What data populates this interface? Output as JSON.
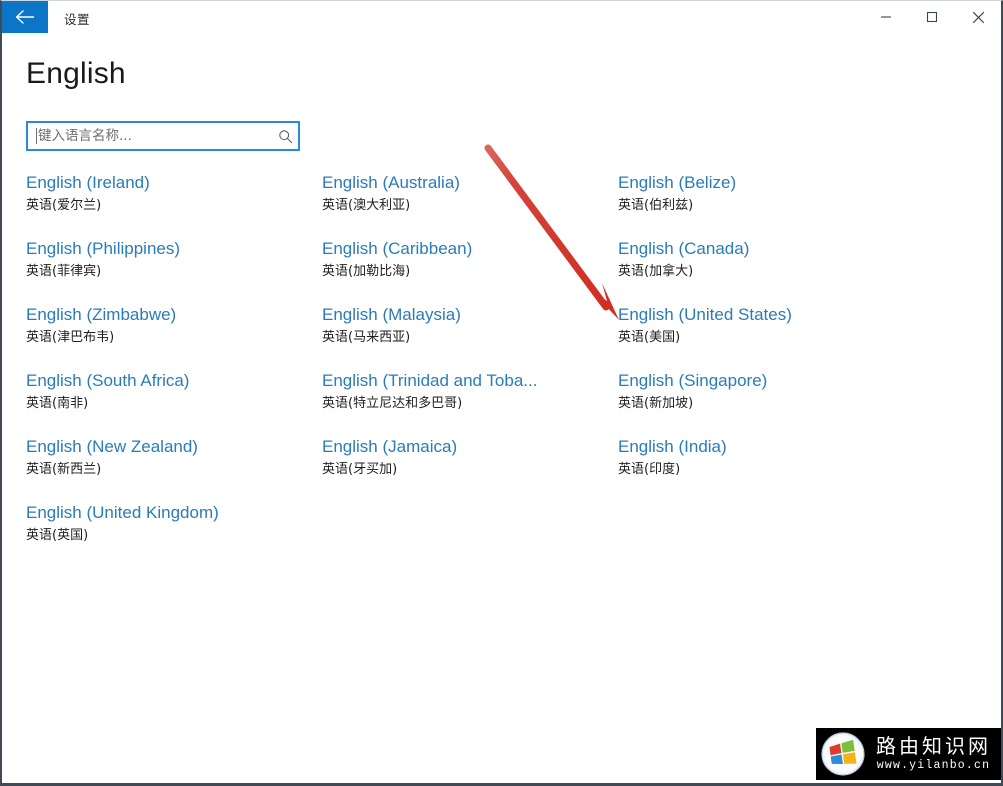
{
  "window": {
    "titlebar": {
      "back_label": "back-arrow",
      "title": "设置",
      "controls": {
        "minimize": "minimize-icon",
        "maximize": "maximize-icon",
        "close": "close-icon"
      }
    },
    "accent_color": "#0b76c8",
    "link_color": "#2a7cb8",
    "border_color": "#414a56"
  },
  "page": {
    "title": "English"
  },
  "search": {
    "placeholder": "键入语言名称...",
    "value": "",
    "icon": "search-icon",
    "border_color": "#2a8ad4"
  },
  "languages": {
    "columns": [
      {
        "items": [
          {
            "name": "English (Ireland)",
            "native": "英语(爱尔兰)"
          },
          {
            "name": "English (Philippines)",
            "native": "英语(菲律宾)"
          },
          {
            "name": "English (Zimbabwe)",
            "native": "英语(津巴布韦)"
          },
          {
            "name": "English (South Africa)",
            "native": "英语(南非)"
          },
          {
            "name": "English (New Zealand)",
            "native": "英语(新西兰)"
          },
          {
            "name": "English (United Kingdom)",
            "native": "英语(英国)"
          }
        ]
      },
      {
        "items": [
          {
            "name": "English (Australia)",
            "native": "英语(澳大利亚)"
          },
          {
            "name": "English (Caribbean)",
            "native": "英语(加勒比海)"
          },
          {
            "name": "English (Malaysia)",
            "native": "英语(马来西亚)"
          },
          {
            "name": "English (Trinidad and Toba...",
            "native": "英语(特立尼达和多巴哥)"
          },
          {
            "name": "English (Jamaica)",
            "native": "英语(牙买加)"
          }
        ]
      },
      {
        "items": [
          {
            "name": "English (Belize)",
            "native": "英语(伯利兹)"
          },
          {
            "name": "English (Canada)",
            "native": "英语(加拿大)"
          },
          {
            "name": "English (United States)",
            "native": "英语(美国)"
          },
          {
            "name": "English (Singapore)",
            "native": "英语(新加坡)"
          },
          {
            "name": "English (India)",
            "native": "英语(印度)"
          }
        ]
      }
    ]
  },
  "annotation": {
    "type": "arrow",
    "color": "#d93b30",
    "target": "English (United States)"
  },
  "watermark": {
    "site_name": "路由知识网",
    "url": "www.yilanbo.cn",
    "logo": "windows-logo-icon"
  }
}
